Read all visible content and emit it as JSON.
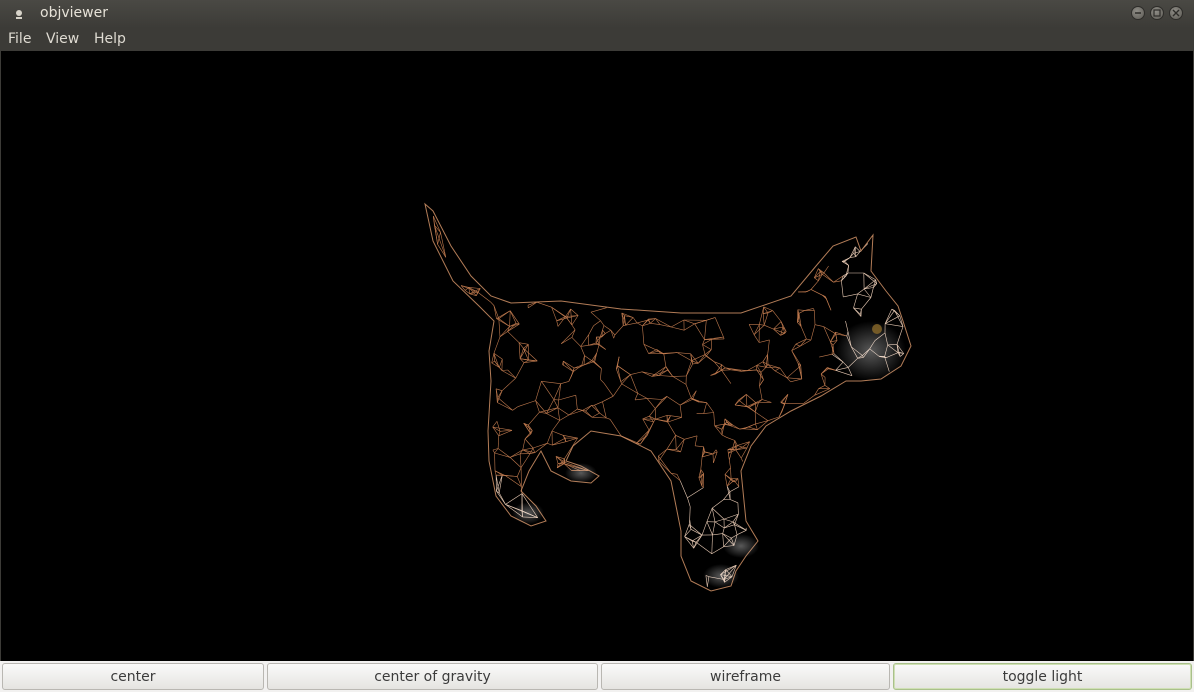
{
  "window": {
    "title": "objviewer"
  },
  "menu": {
    "items": [
      "File",
      "View",
      "Help"
    ]
  },
  "toolbar": {
    "buttons": [
      "center",
      "center of gravity",
      "wireframe",
      "toggle light"
    ]
  },
  "viewport": {
    "render_mode": "wireframe",
    "background": "#000000",
    "mesh_color": "#c07a4e"
  }
}
